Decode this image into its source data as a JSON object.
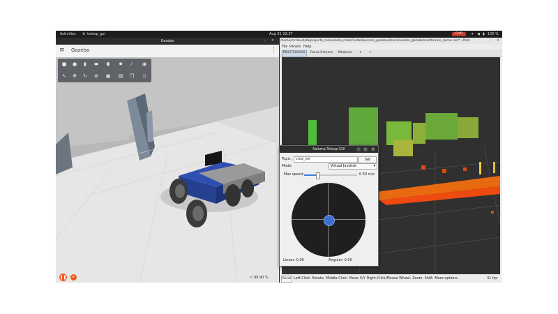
{
  "topbar": {
    "activities": "Activities",
    "app": "teleop_gui",
    "datetime": "Aug 31  22:37",
    "rec": "0:00",
    "battery": "100 %"
  },
  "gazebo": {
    "title": "Gazebo",
    "header_name": "Gazebo",
    "rtf": "99.90 %"
  },
  "rviz": {
    "title": "/home/mrdavidelb/projects_ros/axioma_robot/install/axioma_gazebo/share/axioma_gazebo/rviz/terrain_demo.rviz* - RViz",
    "menu": [
      "File",
      "Panels",
      "Help"
    ],
    "tools": [
      "Move Camera",
      "Focus Camera",
      "Measure"
    ],
    "status": {
      "reset": "Reset",
      "hint": "Left-Click: Rotate. Middle-Click: Move X/Y. Right-Click/Mouse Wheel: Zoom. Shift: More options.",
      "fps": "31 fps"
    }
  },
  "teleop": {
    "title": "Axioma Teleop GUI",
    "topic_label": "Topic:",
    "topic_value": "cmd_vel",
    "set_label": "Set",
    "mode_label": "Mode:",
    "mode_value": "Virtual Joystick",
    "max_speed_label": "Max speed:",
    "max_speed_value": "0.50 m/s",
    "max_speed_fraction": 0.25,
    "linear_label": "Linear: 0.00",
    "angular_label": "Angular: 0.00"
  },
  "colors": {
    "accent": "#f05a22",
    "joystick_knob": "#3d6fd1",
    "robot_body": "#2f4fb0"
  }
}
